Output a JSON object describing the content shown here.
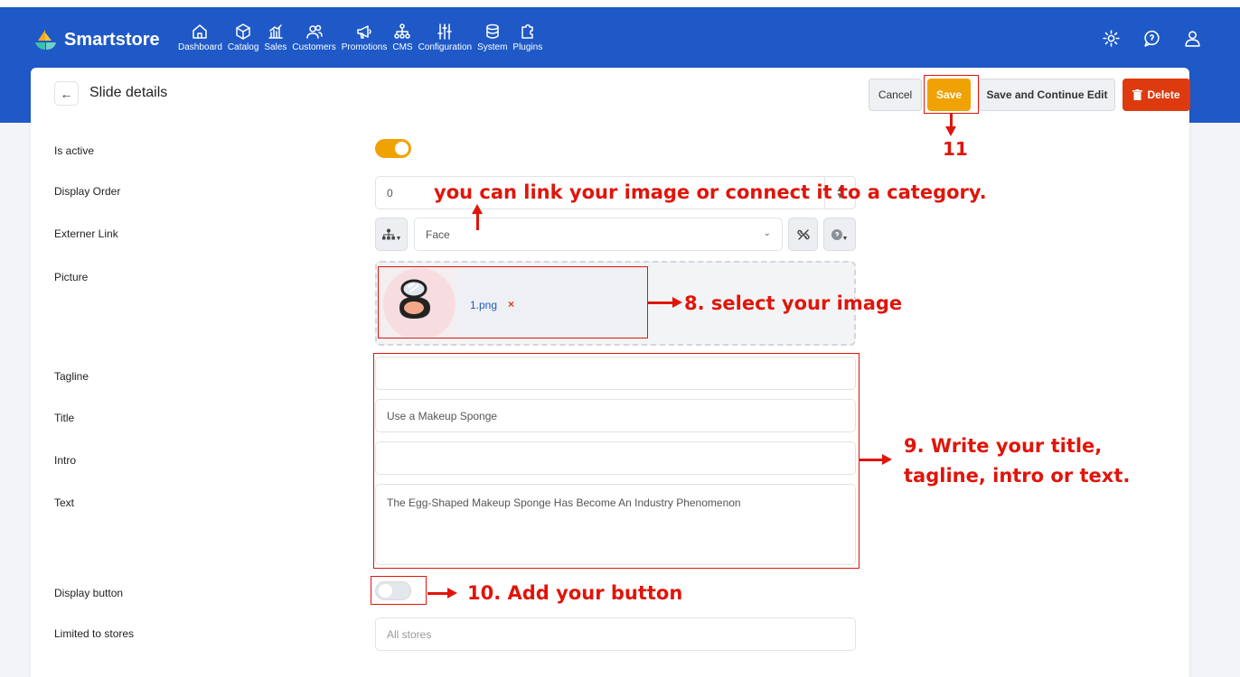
{
  "app": {
    "brand": "Smartstore"
  },
  "nav": [
    {
      "label": "Dashboard",
      "icon": "home-icon"
    },
    {
      "label": "Catalog",
      "icon": "cube-icon"
    },
    {
      "label": "Sales",
      "icon": "chart-icon"
    },
    {
      "label": "Customers",
      "icon": "users-icon"
    },
    {
      "label": "Promotions",
      "icon": "megaphone-icon"
    },
    {
      "label": "CMS",
      "icon": "sitemap-icon"
    },
    {
      "label": "Configuration",
      "icon": "sliders-icon"
    },
    {
      "label": "System",
      "icon": "database-icon"
    },
    {
      "label": "Plugins",
      "icon": "puzzle-icon"
    }
  ],
  "page": {
    "title": "Slide details"
  },
  "buttons": {
    "cancel": "Cancel",
    "save": "Save",
    "save_continue": "Save and Continue Edit",
    "delete": "Delete"
  },
  "form": {
    "is_active": {
      "label": "Is active",
      "value": true
    },
    "display_order": {
      "label": "Display Order",
      "value": "0"
    },
    "externer_link": {
      "label": "Externer Link",
      "value": "Face"
    },
    "picture": {
      "label": "Picture",
      "filename": "1.png",
      "remove": "×"
    },
    "tagline": {
      "label": "Tagline",
      "value": ""
    },
    "title": {
      "label": "Title",
      "value": "Use a Makeup Sponge"
    },
    "intro": {
      "label": "Intro",
      "value": ""
    },
    "text": {
      "label": "Text",
      "value": "The Egg-Shaped Makeup Sponge Has Become An Industry Phenomenon"
    },
    "display_button": {
      "label": "Display button",
      "value": false
    },
    "limited_to_stores": {
      "label": "Limited to stores",
      "placeholder": "All stores"
    }
  },
  "annotations": {
    "step11": "11",
    "link_hint": "you can link your image or connect it to a category.",
    "step8": "8. select your image",
    "step9_line1": "9. Write your title,",
    "step9_line2": "tagline, intro or text.",
    "step10": "10. Add your button"
  },
  "colors": {
    "header": "#1f59c7",
    "accent": "#f0a202",
    "danger": "#dd3a0f",
    "annotation": "#e0150a"
  }
}
